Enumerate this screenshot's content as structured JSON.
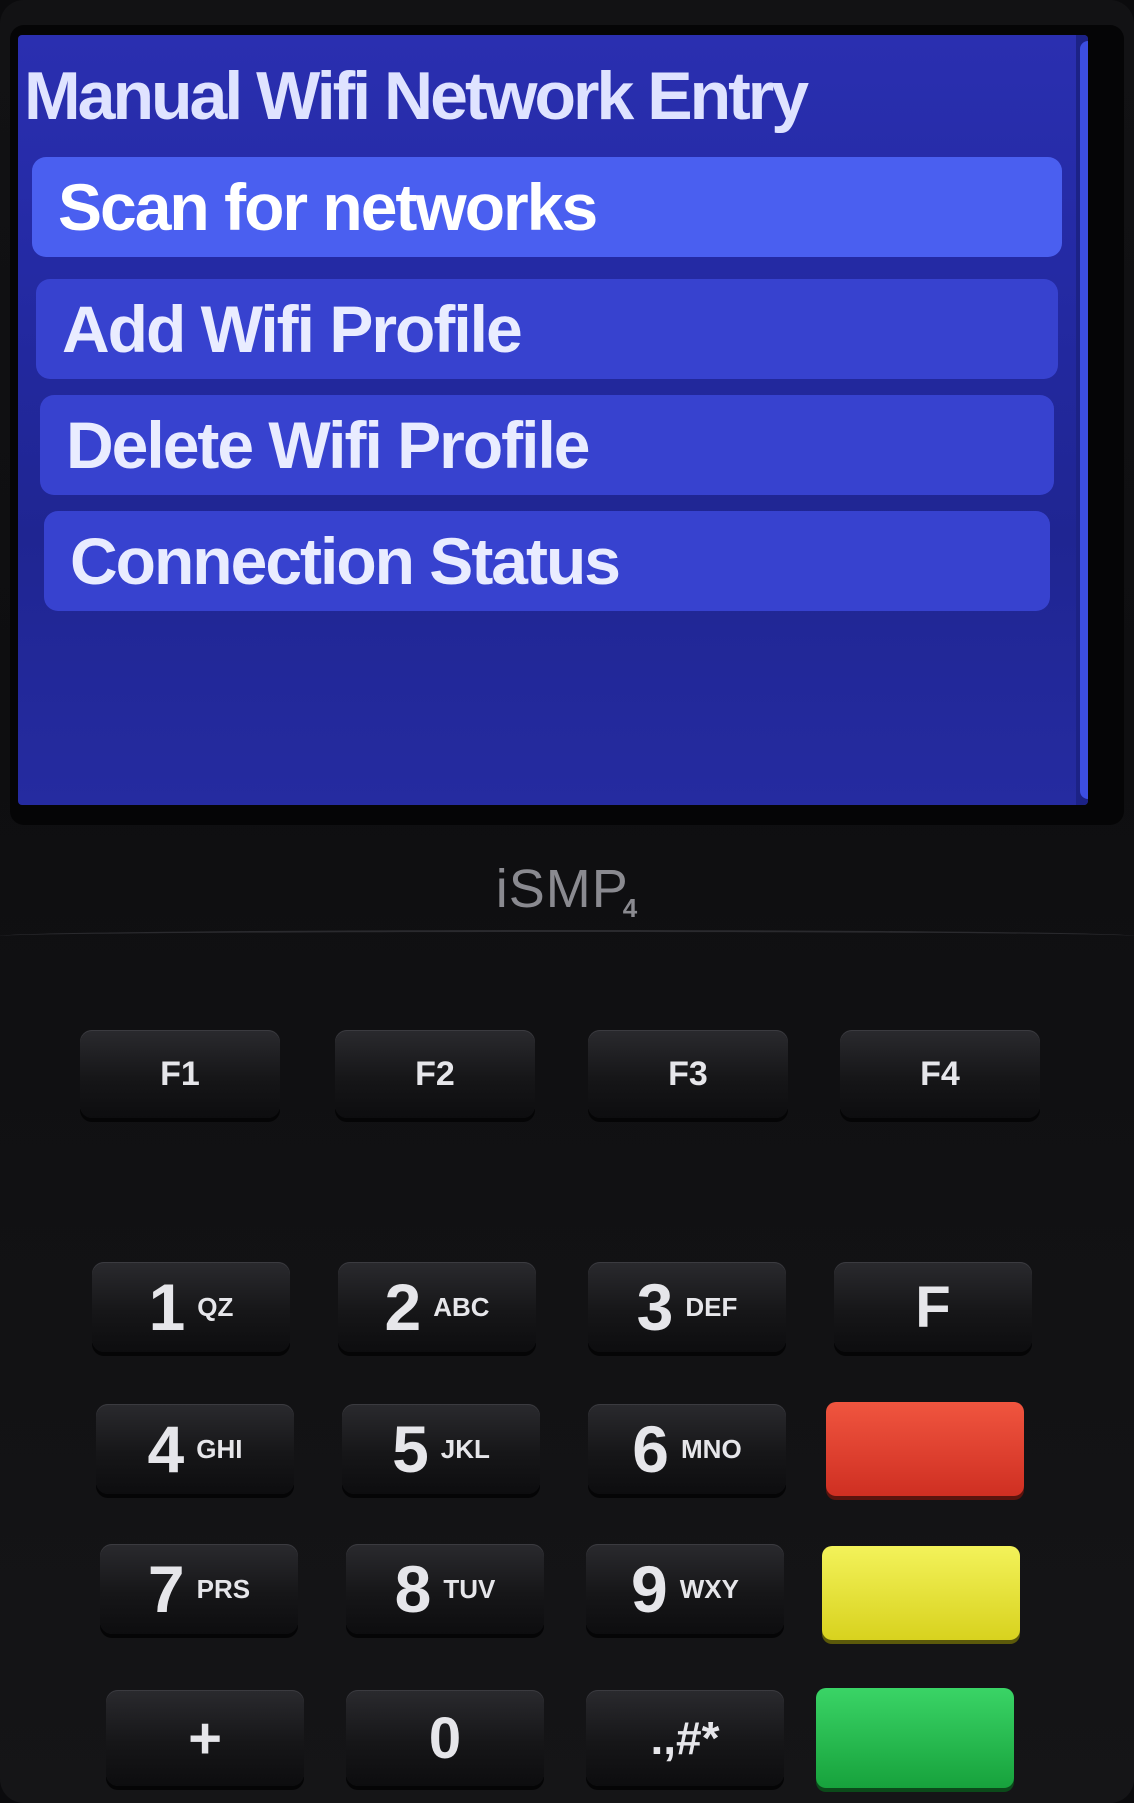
{
  "device": {
    "brand": "iSMP",
    "model_suffix": "4"
  },
  "screen": {
    "title": "Manual Wifi Network Entry",
    "menu_items": [
      {
        "label": "Scan for networks",
        "selected": true
      },
      {
        "label": "Add Wifi Profile",
        "selected": false
      },
      {
        "label": "Delete Wifi Profile",
        "selected": false
      },
      {
        "label": "Connection Status",
        "selected": false
      }
    ]
  },
  "function_keys": [
    "F1",
    "F2",
    "F3",
    "F4"
  ],
  "keypad": {
    "row1": [
      {
        "digit": "1",
        "letters": "QZ"
      },
      {
        "digit": "2",
        "letters": "ABC"
      },
      {
        "digit": "3",
        "letters": "DEF"
      },
      {
        "label": "F"
      }
    ],
    "row2": [
      {
        "digit": "4",
        "letters": "GHI"
      },
      {
        "digit": "5",
        "letters": "JKL"
      },
      {
        "digit": "6",
        "letters": "MNO"
      }
    ],
    "row3": [
      {
        "digit": "7",
        "letters": "PRS"
      },
      {
        "digit": "8",
        "letters": "TUV"
      },
      {
        "digit": "9",
        "letters": "WXY"
      }
    ],
    "row4": [
      {
        "label": "+"
      },
      {
        "label": "0"
      },
      {
        "label": ".,#*"
      }
    ]
  },
  "colors": {
    "screen_bg": "#242aa4",
    "selected_item": "#4a5ff0",
    "cancel_key": "#e0402f",
    "correct_key": "#e6e03a",
    "enter_key": "#23b94b"
  }
}
